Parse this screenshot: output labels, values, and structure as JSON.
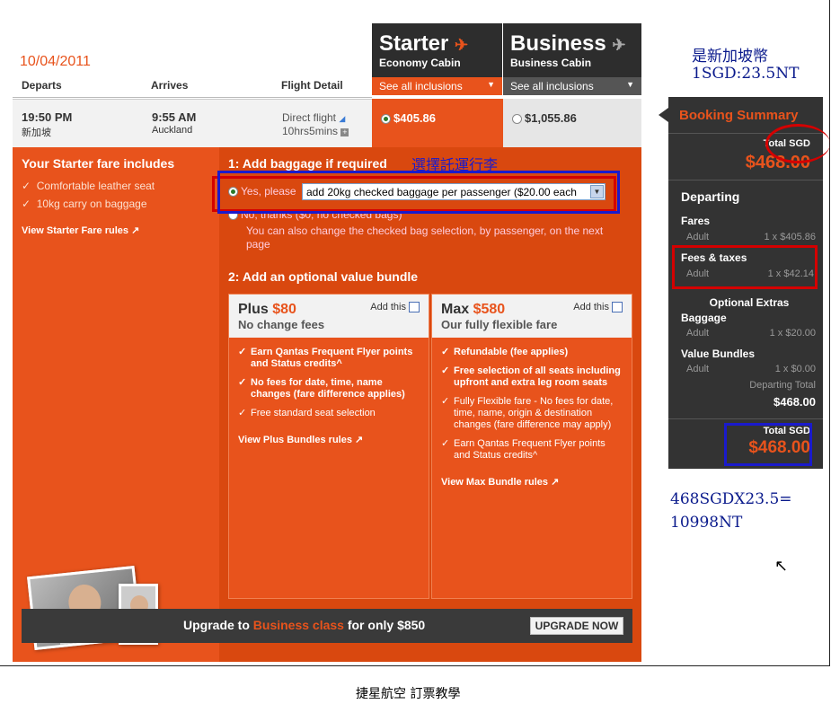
{
  "header": {
    "date": "10/04/2011",
    "col_departs": "Departs",
    "col_arrives": "Arrives",
    "col_flight": "Flight Detail"
  },
  "fares": {
    "starter": {
      "title": "Starter",
      "subtitle": "Economy Cabin",
      "inclusions": "See all inclusions",
      "price": "$405.86"
    },
    "business": {
      "title": "Business",
      "subtitle": "Business Cabin",
      "inclusions": "See all inclusions",
      "price": "$1,055.86"
    }
  },
  "flight": {
    "depart_time": "19:50 PM",
    "depart_city": "新加坡",
    "arrive_time": "9:55 AM",
    "arrive_city": "Auckland",
    "type": "Direct flight",
    "duration": "10hrs5mins"
  },
  "left": {
    "title": "Your Starter fare includes",
    "items": [
      "Comfortable leather seat",
      "10kg carry on baggage"
    ],
    "rules_link": "View Starter Fare rules"
  },
  "baggage": {
    "heading": "1: Add baggage if required",
    "yes_label": "Yes, please",
    "select_value": "add 20kg checked baggage per passenger ($20.00 each",
    "no_label": "No, thanks ($0, no checked bags)",
    "note": "You can also change the checked bag selection, by passenger, on the next page"
  },
  "bundles": {
    "heading": "2: Add an optional value bundle",
    "add_label": "Add this",
    "plus": {
      "name": "Plus",
      "price": "$80",
      "sub": "No change fees",
      "items": [
        "Earn Qantas Frequent Flyer points and Status credits^",
        "No fees for date, time, name changes (fare difference applies)",
        "Free standard seat selection"
      ],
      "rules": "View Plus Bundles rules"
    },
    "max": {
      "name": "Max",
      "price": "$580",
      "sub": "Our fully flexible fare",
      "items": [
        "Refundable (fee applies)",
        "Free selection of all seats including upfront and extra leg room seats",
        "Fully Flexible fare - No fees for date, time, name, origin & destination changes (fare difference may apply)",
        "Earn Qantas Frequent Flyer points and Status credits^"
      ],
      "rules": "View Max Bundle rules"
    }
  },
  "upgrade": {
    "pre": "Upgrade to ",
    "highlight": "Business class",
    "post": " for only $850",
    "button": "UPGRADE NOW"
  },
  "summary": {
    "title": "Booking Summary",
    "total_label": "Total SGD",
    "total_top": "$468.00",
    "departing": "Departing",
    "fares": "Fares",
    "fares_adult": "Adult",
    "fares_val": "1 x $405.86",
    "fees": "Fees & taxes",
    "fees_adult": "Adult",
    "fees_val": "1 x $42.14",
    "optional": "Optional Extras",
    "baggage": "Baggage",
    "baggage_adult": "Adult",
    "baggage_val": "1 x $20.00",
    "bundles": "Value Bundles",
    "bundles_adult": "Adult",
    "bundles_val": "1 x $0.00",
    "dep_total_label": "Departing Total",
    "dep_total": "$468.00",
    "total_bottom": "$468.00"
  },
  "annotations": {
    "currency": "是新加坡幣",
    "rate": "1SGD:23.5NT",
    "baggage_note": "選擇託運行李",
    "calc1": "468SGDX23.5=",
    "calc2": "10998NT",
    "caption": "捷星航空 訂票教學"
  },
  "colors": {
    "accent": "#e8531c",
    "panel_dark": "#333333",
    "annot_blue": "#0a1a8c",
    "annot_red": "#d40000"
  }
}
